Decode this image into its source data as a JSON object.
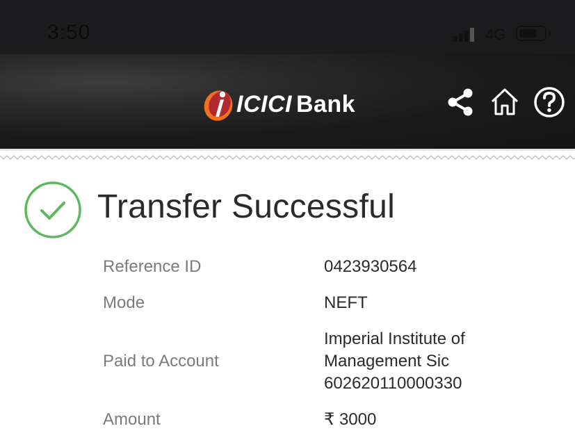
{
  "status_bar": {
    "time": "3:50",
    "network": "4G"
  },
  "header": {
    "logo_text": "ICICI",
    "logo_bank": "Bank",
    "icons": [
      "share-icon",
      "home-icon",
      "help-icon"
    ]
  },
  "result": {
    "title": "Transfer Successful",
    "status_color": "#5cb85c"
  },
  "details": [
    {
      "label": "Reference ID",
      "value": "0423930564"
    },
    {
      "label": "Mode",
      "value": "NEFT"
    },
    {
      "label": "Paid to Account",
      "value_lines": [
        "Imperial Institute of",
        "Management Sic",
        "602620110000330"
      ]
    },
    {
      "label": "Amount",
      "value": "₹ 3000"
    }
  ]
}
